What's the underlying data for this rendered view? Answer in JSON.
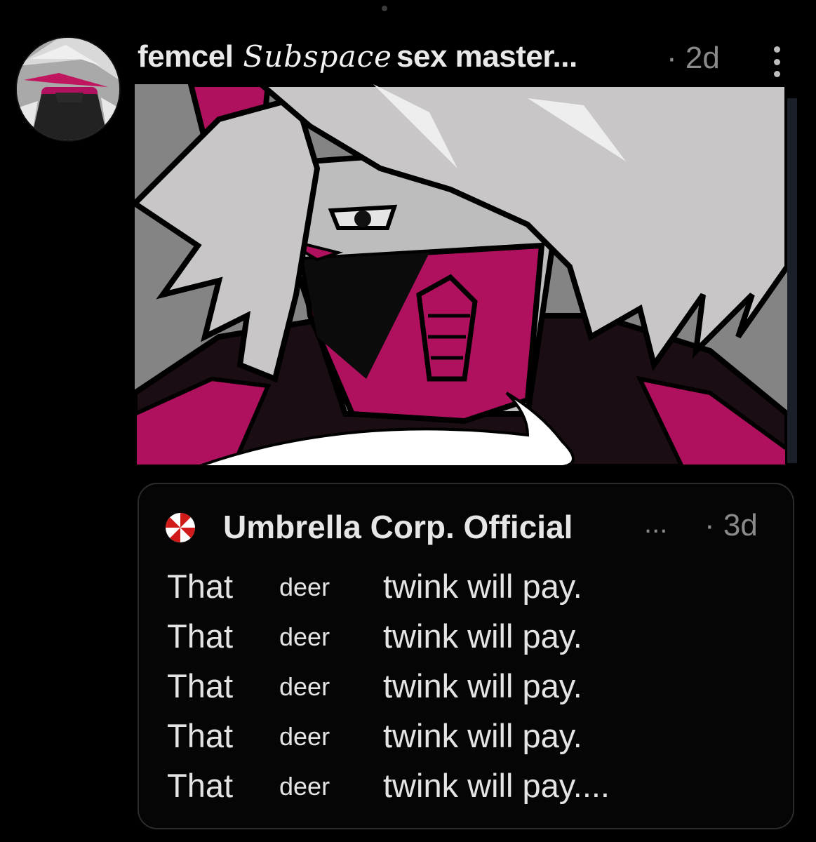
{
  "header": {
    "name_part1": "femcel",
    "name_script": "Subspace",
    "name_part2": "sex master...",
    "time": "· 2d"
  },
  "quote": {
    "author": "Umbrella Corp. Official",
    "ellipsis": "...",
    "time": "· 3d",
    "lines": [
      {
        "a": "That",
        "b": "deer",
        "c": "twink will pay."
      },
      {
        "a": "That",
        "b": "deer",
        "c": "twink will pay."
      },
      {
        "a": "That",
        "b": "deer",
        "c": "twink will pay."
      },
      {
        "a": "That",
        "b": "deer",
        "c": "twink will pay."
      },
      {
        "a": "That",
        "b": "deer",
        "c": "twink will pay...."
      }
    ]
  },
  "colors": {
    "background": "#000000",
    "accent_magenta": "#b0115f",
    "art_background": "#848484"
  },
  "icons": [
    "more-vert-icon",
    "umbrella-logo-icon"
  ]
}
